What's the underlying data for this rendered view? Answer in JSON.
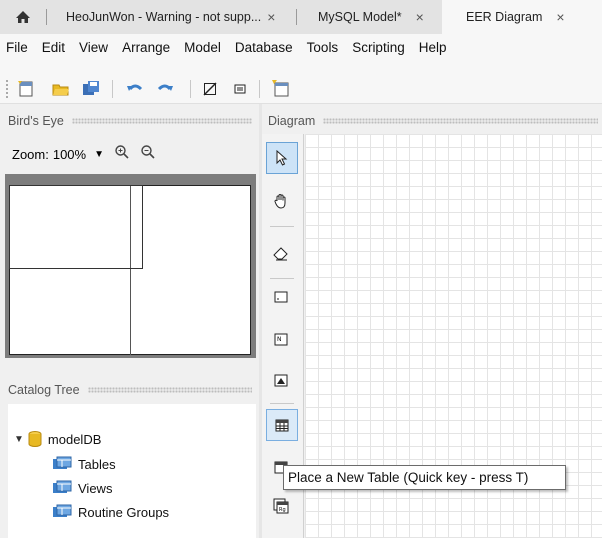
{
  "tabs": [
    {
      "label": "HeoJunWon - Warning - not supp...",
      "close": "×"
    },
    {
      "label": "MySQL Model*",
      "close": "×"
    },
    {
      "label": "EER Diagram",
      "close": "×"
    }
  ],
  "menu": [
    "File",
    "Edit",
    "View",
    "Arrange",
    "Model",
    "Database",
    "Tools",
    "Scripting",
    "Help"
  ],
  "toolbar_icons": [
    "new-document-icon",
    "open-folder-icon",
    "save-icon",
    "undo-icon",
    "redo-icon",
    "toggle-grid-icon",
    "align-objects-icon",
    "new-diagram-icon"
  ],
  "birds_eye": {
    "title": "Bird's Eye",
    "zoom_label": "Zoom:",
    "zoom_value": "100%"
  },
  "catalog_tree": {
    "title": "Catalog Tree",
    "root": "modelDB",
    "children": [
      "Tables",
      "Views",
      "Routine Groups"
    ]
  },
  "diagram": {
    "title": "Diagram"
  },
  "palette_tools": [
    "pointer",
    "hand",
    "eraser",
    "layer",
    "note",
    "image",
    "table",
    "view",
    "routine-group"
  ],
  "tooltip": "Place a New Table (Quick key - press T)",
  "colors": {
    "selected_tool": "#cde3f7",
    "folder_icon": "#e8b923",
    "table_icon": "#3b7fc9"
  }
}
